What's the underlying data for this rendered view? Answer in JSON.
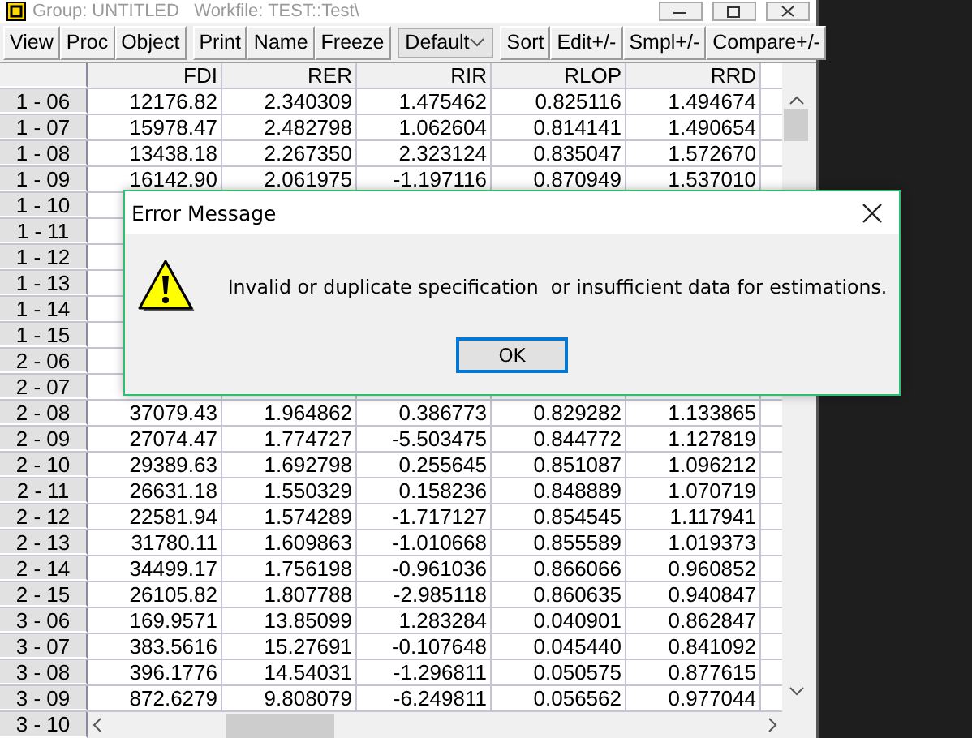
{
  "window": {
    "title": "Group: UNTITLED   Workfile: TEST::Test\\"
  },
  "toolbar": {
    "items": [
      {
        "kind": "button",
        "label": "View"
      },
      {
        "kind": "button",
        "label": "Proc"
      },
      {
        "kind": "button",
        "label": "Object"
      },
      {
        "kind": "separator"
      },
      {
        "kind": "button",
        "label": "Print"
      },
      {
        "kind": "button",
        "label": "Name"
      },
      {
        "kind": "button",
        "label": "Freeze"
      },
      {
        "kind": "separator"
      },
      {
        "kind": "dropdown",
        "label": "Default"
      },
      {
        "kind": "separator"
      },
      {
        "kind": "button",
        "label": "Sort"
      },
      {
        "kind": "button",
        "label": "Edit+/-"
      },
      {
        "kind": "button",
        "label": "Smpl+/-"
      },
      {
        "kind": "button",
        "label": "Compare+/-"
      }
    ]
  },
  "table": {
    "columns": [
      "FDI",
      "RER",
      "RIR",
      "RLOP",
      "RRD"
    ],
    "rows": [
      {
        "label": "1 - 06",
        "values": [
          "12176.82",
          "2.340309",
          "1.475462",
          "0.825116",
          "1.494674"
        ]
      },
      {
        "label": "1 - 07",
        "values": [
          "15978.47",
          "2.482798",
          "1.062604",
          "0.814141",
          "1.490654"
        ]
      },
      {
        "label": "1 - 08",
        "values": [
          "13438.18",
          "2.267350",
          "2.323124",
          "0.835047",
          "1.572670"
        ]
      },
      {
        "label": "1 - 09",
        "values": [
          "16142.90",
          "2.061975",
          "-1.197116",
          "0.870949",
          "1.537010"
        ]
      },
      {
        "label": "1 - 10"
      },
      {
        "label": "1 - 11"
      },
      {
        "label": "1 - 12"
      },
      {
        "label": "1 - 13"
      },
      {
        "label": "1 - 14"
      },
      {
        "label": "1 - 15"
      },
      {
        "label": "2 - 06"
      },
      {
        "label": "2 - 07"
      },
      {
        "label": "2 - 08",
        "values": [
          "37079.43",
          "1.964862",
          "0.386773",
          "0.829282",
          "1.133865"
        ]
      },
      {
        "label": "2 - 09",
        "values": [
          "27074.47",
          "1.774727",
          "-5.503475",
          "0.844772",
          "1.127819"
        ]
      },
      {
        "label": "2 - 10",
        "values": [
          "29389.63",
          "1.692798",
          "0.255645",
          "0.851087",
          "1.096212"
        ]
      },
      {
        "label": "2 - 11",
        "values": [
          "26631.18",
          "1.550329",
          "0.158236",
          "0.848889",
          "1.070719"
        ]
      },
      {
        "label": "2 - 12",
        "values": [
          "22581.94",
          "1.574289",
          "-1.717127",
          "0.854545",
          "1.117941"
        ]
      },
      {
        "label": "2 - 13",
        "values": [
          "31780.11",
          "1.609863",
          "-1.010668",
          "0.855589",
          "1.019373"
        ]
      },
      {
        "label": "2 - 14",
        "values": [
          "34499.17",
          "1.756198",
          "-0.961036",
          "0.866066",
          "0.960852"
        ]
      },
      {
        "label": "2 - 15",
        "values": [
          "26105.82",
          "1.807788",
          "-2.985118",
          "0.860635",
          "0.940847"
        ]
      },
      {
        "label": "3 - 06",
        "values": [
          "169.9571",
          "13.85099",
          "1.283284",
          "0.040901",
          "0.862847"
        ]
      },
      {
        "label": "3 - 07",
        "values": [
          "383.5616",
          "15.27691",
          "-0.107648",
          "0.045440",
          "0.841092"
        ]
      },
      {
        "label": "3 - 08",
        "values": [
          "396.1776",
          "14.54031",
          "-1.296811",
          "0.050575",
          "0.877615"
        ]
      },
      {
        "label": "3 - 09",
        "values": [
          "872.6279",
          "9.808079",
          "-6.249811",
          "0.056562",
          "0.977044"
        ]
      },
      {
        "label": "3 - 10"
      }
    ]
  },
  "dialog": {
    "title": "Error Message",
    "message": "Invalid or duplicate specification  or insufficient data for estimations.",
    "button": "OK"
  }
}
